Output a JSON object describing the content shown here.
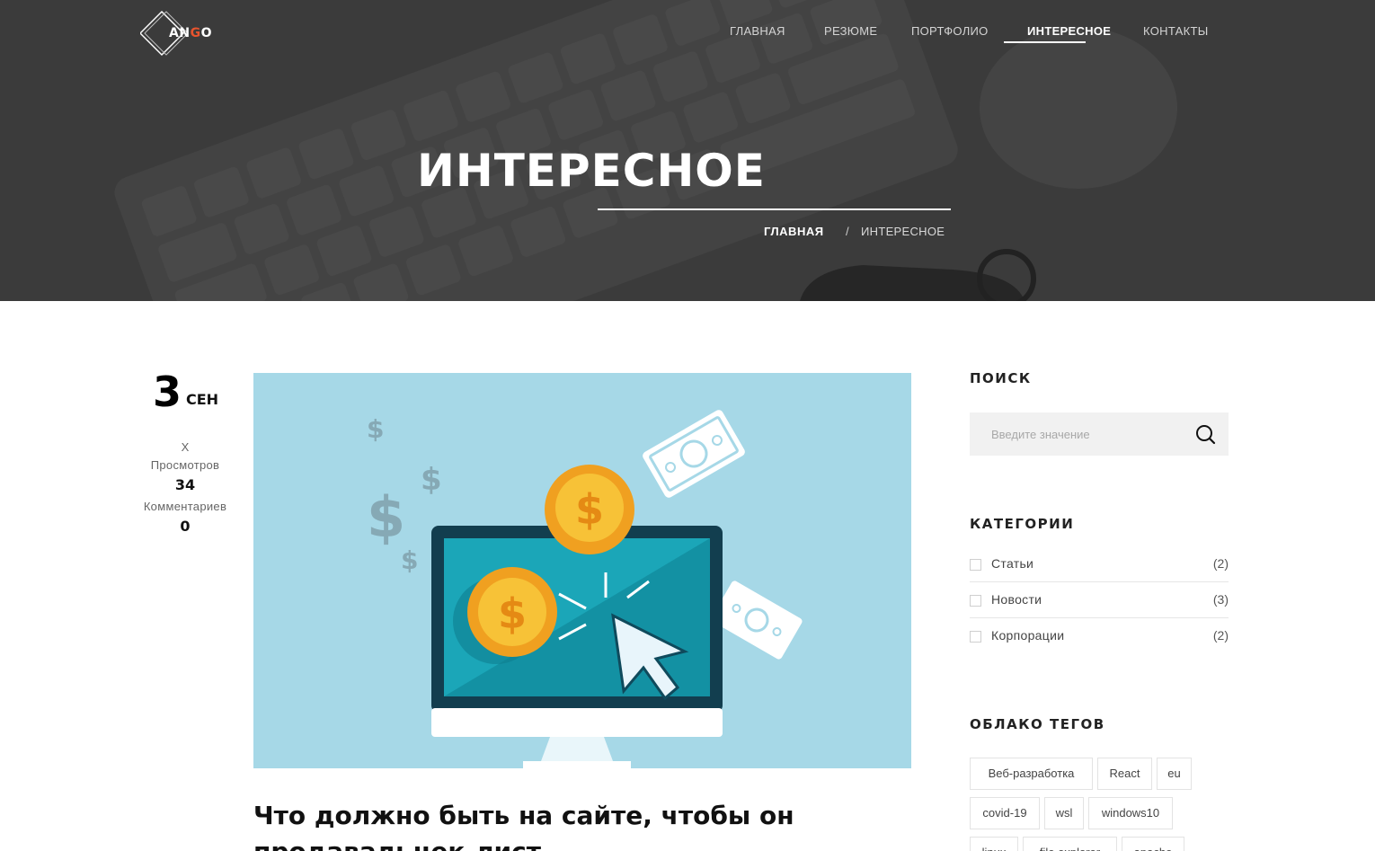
{
  "brand": {
    "logo_text_a": "AN",
    "logo_text_b": "G",
    "logo_text_c": "O",
    "accent_color": "#e8542e"
  },
  "nav": {
    "items": [
      {
        "label": "ГЛАВНАЯ"
      },
      {
        "label": "РЕЗЮМЕ"
      },
      {
        "label": "ПОРТФОЛИО"
      },
      {
        "label": "ИНТЕРЕСНОЕ",
        "active": true
      },
      {
        "label": "КОНТАКТЫ"
      }
    ]
  },
  "hero": {
    "title": "ИНТЕРЕСНОЕ",
    "breadcrumb": {
      "home": "ГЛАВНАЯ",
      "separator": "/",
      "current": "ИНТЕРЕСНОЕ"
    }
  },
  "post": {
    "date_day": "3",
    "date_month": "СЕН",
    "author": "X",
    "views_label": "Просмотров",
    "views": "34",
    "comments_label": "Комментариев",
    "comments": "0",
    "title": "Что должно быть на сайте, чтобы он продавал: чек-лист"
  },
  "sidebar": {
    "search": {
      "title": "ПОИСК",
      "placeholder": "Введите значение",
      "icon": "search-icon"
    },
    "categories": {
      "title": "КАТЕГОРИИ",
      "items": [
        {
          "name": "Статьи",
          "count": "(2)"
        },
        {
          "name": "Новости",
          "count": "(3)"
        },
        {
          "name": "Корпорации",
          "count": "(2)"
        }
      ]
    },
    "tags": {
      "title": "ОБЛАКО ТЕГОВ",
      "items": [
        "Веб-разработка",
        "React",
        "eu",
        "covid-19",
        "wsl",
        "windows10",
        "linux",
        "file explorer",
        "apache"
      ]
    }
  }
}
